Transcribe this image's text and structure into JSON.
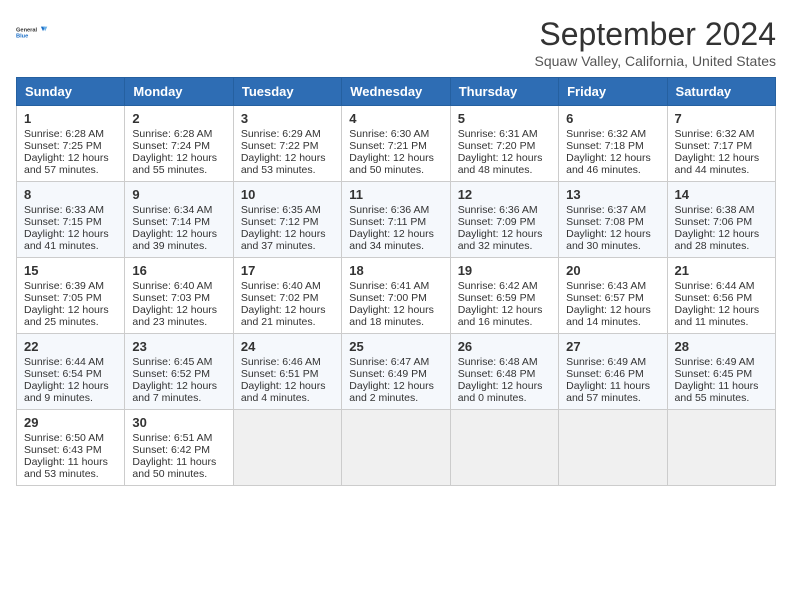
{
  "header": {
    "logo_line1": "General",
    "logo_line2": "Blue",
    "month": "September 2024",
    "location": "Squaw Valley, California, United States"
  },
  "weekdays": [
    "Sunday",
    "Monday",
    "Tuesday",
    "Wednesday",
    "Thursday",
    "Friday",
    "Saturday"
  ],
  "weeks": [
    [
      {
        "day": "1",
        "lines": [
          "Sunrise: 6:28 AM",
          "Sunset: 7:25 PM",
          "Daylight: 12 hours",
          "and 57 minutes."
        ]
      },
      {
        "day": "2",
        "lines": [
          "Sunrise: 6:28 AM",
          "Sunset: 7:24 PM",
          "Daylight: 12 hours",
          "and 55 minutes."
        ]
      },
      {
        "day": "3",
        "lines": [
          "Sunrise: 6:29 AM",
          "Sunset: 7:22 PM",
          "Daylight: 12 hours",
          "and 53 minutes."
        ]
      },
      {
        "day": "4",
        "lines": [
          "Sunrise: 6:30 AM",
          "Sunset: 7:21 PM",
          "Daylight: 12 hours",
          "and 50 minutes."
        ]
      },
      {
        "day": "5",
        "lines": [
          "Sunrise: 6:31 AM",
          "Sunset: 7:20 PM",
          "Daylight: 12 hours",
          "and 48 minutes."
        ]
      },
      {
        "day": "6",
        "lines": [
          "Sunrise: 6:32 AM",
          "Sunset: 7:18 PM",
          "Daylight: 12 hours",
          "and 46 minutes."
        ]
      },
      {
        "day": "7",
        "lines": [
          "Sunrise: 6:32 AM",
          "Sunset: 7:17 PM",
          "Daylight: 12 hours",
          "and 44 minutes."
        ]
      }
    ],
    [
      {
        "day": "8",
        "lines": [
          "Sunrise: 6:33 AM",
          "Sunset: 7:15 PM",
          "Daylight: 12 hours",
          "and 41 minutes."
        ]
      },
      {
        "day": "9",
        "lines": [
          "Sunrise: 6:34 AM",
          "Sunset: 7:14 PM",
          "Daylight: 12 hours",
          "and 39 minutes."
        ]
      },
      {
        "day": "10",
        "lines": [
          "Sunrise: 6:35 AM",
          "Sunset: 7:12 PM",
          "Daylight: 12 hours",
          "and 37 minutes."
        ]
      },
      {
        "day": "11",
        "lines": [
          "Sunrise: 6:36 AM",
          "Sunset: 7:11 PM",
          "Daylight: 12 hours",
          "and 34 minutes."
        ]
      },
      {
        "day": "12",
        "lines": [
          "Sunrise: 6:36 AM",
          "Sunset: 7:09 PM",
          "Daylight: 12 hours",
          "and 32 minutes."
        ]
      },
      {
        "day": "13",
        "lines": [
          "Sunrise: 6:37 AM",
          "Sunset: 7:08 PM",
          "Daylight: 12 hours",
          "and 30 minutes."
        ]
      },
      {
        "day": "14",
        "lines": [
          "Sunrise: 6:38 AM",
          "Sunset: 7:06 PM",
          "Daylight: 12 hours",
          "and 28 minutes."
        ]
      }
    ],
    [
      {
        "day": "15",
        "lines": [
          "Sunrise: 6:39 AM",
          "Sunset: 7:05 PM",
          "Daylight: 12 hours",
          "and 25 minutes."
        ]
      },
      {
        "day": "16",
        "lines": [
          "Sunrise: 6:40 AM",
          "Sunset: 7:03 PM",
          "Daylight: 12 hours",
          "and 23 minutes."
        ]
      },
      {
        "day": "17",
        "lines": [
          "Sunrise: 6:40 AM",
          "Sunset: 7:02 PM",
          "Daylight: 12 hours",
          "and 21 minutes."
        ]
      },
      {
        "day": "18",
        "lines": [
          "Sunrise: 6:41 AM",
          "Sunset: 7:00 PM",
          "Daylight: 12 hours",
          "and 18 minutes."
        ]
      },
      {
        "day": "19",
        "lines": [
          "Sunrise: 6:42 AM",
          "Sunset: 6:59 PM",
          "Daylight: 12 hours",
          "and 16 minutes."
        ]
      },
      {
        "day": "20",
        "lines": [
          "Sunrise: 6:43 AM",
          "Sunset: 6:57 PM",
          "Daylight: 12 hours",
          "and 14 minutes."
        ]
      },
      {
        "day": "21",
        "lines": [
          "Sunrise: 6:44 AM",
          "Sunset: 6:56 PM",
          "Daylight: 12 hours",
          "and 11 minutes."
        ]
      }
    ],
    [
      {
        "day": "22",
        "lines": [
          "Sunrise: 6:44 AM",
          "Sunset: 6:54 PM",
          "Daylight: 12 hours",
          "and 9 minutes."
        ]
      },
      {
        "day": "23",
        "lines": [
          "Sunrise: 6:45 AM",
          "Sunset: 6:52 PM",
          "Daylight: 12 hours",
          "and 7 minutes."
        ]
      },
      {
        "day": "24",
        "lines": [
          "Sunrise: 6:46 AM",
          "Sunset: 6:51 PM",
          "Daylight: 12 hours",
          "and 4 minutes."
        ]
      },
      {
        "day": "25",
        "lines": [
          "Sunrise: 6:47 AM",
          "Sunset: 6:49 PM",
          "Daylight: 12 hours",
          "and 2 minutes."
        ]
      },
      {
        "day": "26",
        "lines": [
          "Sunrise: 6:48 AM",
          "Sunset: 6:48 PM",
          "Daylight: 12 hours",
          "and 0 minutes."
        ]
      },
      {
        "day": "27",
        "lines": [
          "Sunrise: 6:49 AM",
          "Sunset: 6:46 PM",
          "Daylight: 11 hours",
          "and 57 minutes."
        ]
      },
      {
        "day": "28",
        "lines": [
          "Sunrise: 6:49 AM",
          "Sunset: 6:45 PM",
          "Daylight: 11 hours",
          "and 55 minutes."
        ]
      }
    ],
    [
      {
        "day": "29",
        "lines": [
          "Sunrise: 6:50 AM",
          "Sunset: 6:43 PM",
          "Daylight: 11 hours",
          "and 53 minutes."
        ]
      },
      {
        "day": "30",
        "lines": [
          "Sunrise: 6:51 AM",
          "Sunset: 6:42 PM",
          "Daylight: 11 hours",
          "and 50 minutes."
        ]
      },
      {
        "day": "",
        "lines": []
      },
      {
        "day": "",
        "lines": []
      },
      {
        "day": "",
        "lines": []
      },
      {
        "day": "",
        "lines": []
      },
      {
        "day": "",
        "lines": []
      }
    ]
  ]
}
